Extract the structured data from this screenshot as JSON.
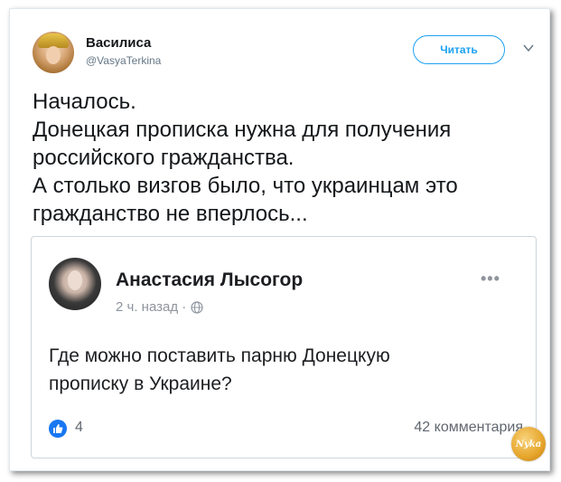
{
  "tweet": {
    "author_name": "Василиса",
    "author_handle": "@VasyaTerkina",
    "follow_label": "Читать",
    "text": "Началось.\nДонецкая прописка нужна для получения российского гражданства.\nА столько визгов было, что украинцам это гражданство не вперлось..."
  },
  "embedded_post": {
    "author_name": "Анастасия Лысогор",
    "time": "2 ч. назад ·",
    "more": "•••",
    "text": "Где можно поставить парню Донецкую\nпрописку в Украине?",
    "likes": "4",
    "comments": "42 комментария"
  },
  "watermark": {
    "text": "Nyka"
  },
  "colors": {
    "twitter_blue": "#1da1f2",
    "facebook_blue": "#1877f2",
    "text_dark": "#14171a",
    "muted": "#657786"
  },
  "icons": [
    "chevron-down-icon",
    "globe-icon",
    "like-icon"
  ]
}
